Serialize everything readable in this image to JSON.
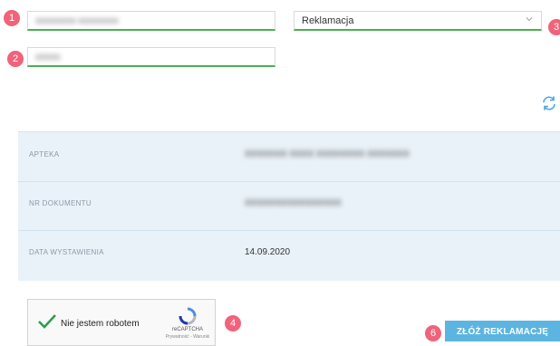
{
  "badges": {
    "b1": "1",
    "b2": "2",
    "b3": "3",
    "b4": "4",
    "b5": "5",
    "b6": "6"
  },
  "form": {
    "field1_value": "xxxxxxxx-xxxxxxxx",
    "field2_value": "xxxxx",
    "type_select_value": "Reklamacja",
    "refresh_icon": "refresh-icon",
    "accent_color": "#4caf50"
  },
  "details": {
    "rows": [
      {
        "label": "APTEKA",
        "value": "XXXXXXX XXXX XXXXXXXX XXXXXXX"
      },
      {
        "label": "NR DOKUMENTU",
        "value": "XXXXXXXXXXXXXXXX"
      },
      {
        "label": "DATA WYSTAWIENIA",
        "value": "14.09.2020"
      }
    ],
    "panel_color": "#e9f2f9"
  },
  "captcha": {
    "label": "Nie jestem robotem",
    "brand": "reCAPTCHA",
    "links": "Prywatność - Warunki"
  },
  "submit": {
    "label": "ZŁÓŻ REKLAMACJĘ",
    "color": "#5bb5e0"
  },
  "badge_color": "#f0637a"
}
